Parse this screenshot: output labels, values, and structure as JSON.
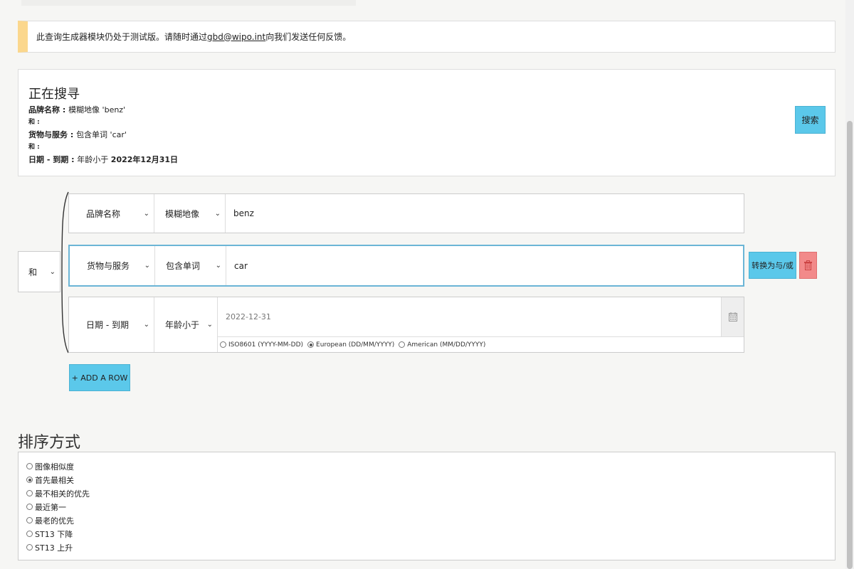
{
  "notice": {
    "text_before": "此查询生成器模块仍处于测试版。请随时通过 ",
    "email": "gbd@wipo.int",
    "text_after": "向我们发送任何反馈。"
  },
  "summary": {
    "title": "正在搜寻",
    "line1_label": "品牌名称",
    "line1_sep": " : ",
    "line1_value": "模糊地像 'benz'",
    "and1": "和 :",
    "line2_label": "货物与服务",
    "line2_sep": " : ",
    "line2_value": "包含单词 'car'",
    "and2": "和 :",
    "line3_label": "日期 - 到期",
    "line3_sep": " : ",
    "line3_value_prefix": "年龄小于 ",
    "line3_value_bold": "2022年12月31日",
    "search_button": "搜索"
  },
  "query": {
    "logic_operator": "和",
    "rows": [
      {
        "field": "品牌名称",
        "operator": "模糊地像",
        "value": "benz"
      },
      {
        "field": "货物与服务",
        "operator": "包含单词",
        "value": "car"
      },
      {
        "field": "日期 - 到期",
        "operator": "年龄小于",
        "placeholder": "2022-12-31"
      }
    ],
    "date_formats": [
      "ISO8601 (YYYY-MM-DD)",
      "European (DD/MM/YYYY)",
      "American (MM/DD/YYYY)"
    ],
    "date_format_selected": "European (DD/MM/YYYY)",
    "convert_button": "转换为与/或",
    "add_row_button": "+ ADD A ROW"
  },
  "sort": {
    "heading": "排序方式",
    "options": [
      "图像相似度",
      "首先最相关",
      "最不相关的优先",
      "最近第一",
      "最老的优先",
      "ST13 下降",
      "ST13 上升"
    ],
    "selected": "首先最相关"
  },
  "icons": {
    "chevron": "chevron-down-icon",
    "calendar": "calendar-icon",
    "trash": "trash-icon"
  },
  "colors": {
    "accent_button": "#5bc8ea",
    "delete_button": "#f28a8a",
    "notice_bar": "#fbd78d",
    "active_row_border": "#6bb5d6"
  }
}
